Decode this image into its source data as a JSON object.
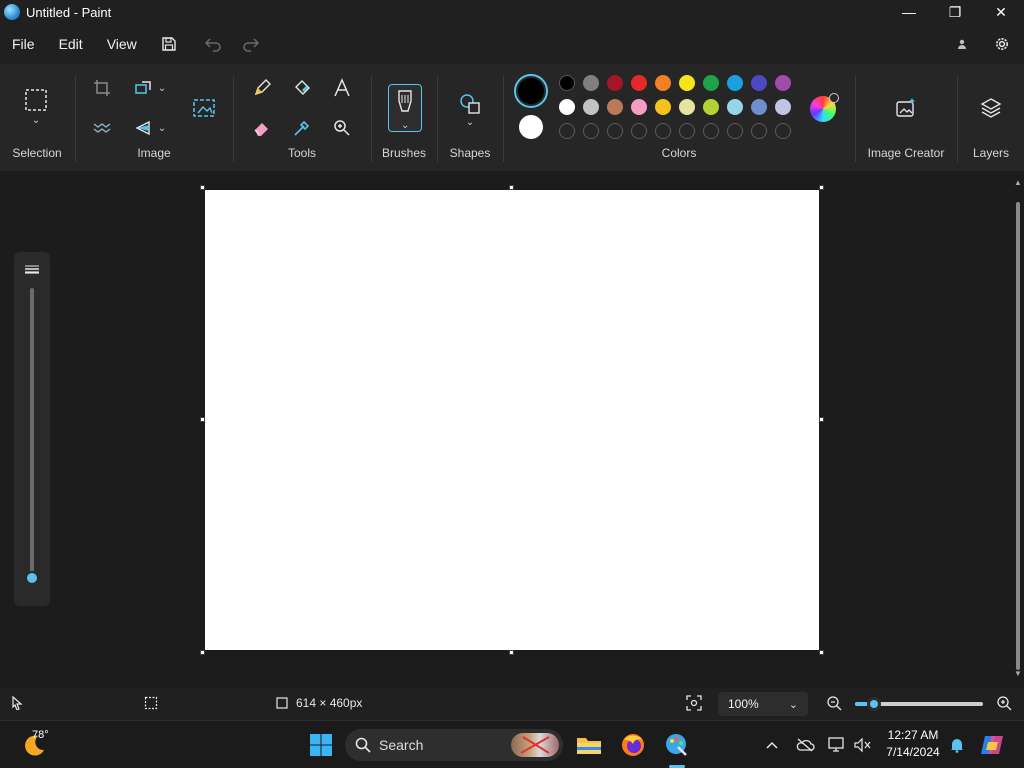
{
  "window": {
    "title": "Untitled - Paint",
    "minimize_glyph": "—",
    "restore_glyph": "❐",
    "close_glyph": "✕"
  },
  "menu": {
    "items": [
      "File",
      "Edit",
      "View"
    ]
  },
  "ribbon": {
    "groups": {
      "selection": "Selection",
      "image": "Image",
      "tools": "Tools",
      "brushes": "Brushes",
      "shapes": "Shapes",
      "colors": "Colors",
      "image_creator": "Image Creator",
      "layers": "Layers"
    },
    "colors": {
      "primary": "#000000",
      "secondary": "#ffffff",
      "row1": [
        "#000000",
        "#7f7f7f",
        "#a4152a",
        "#e52929",
        "#f48023",
        "#f5e41c",
        "#1ea34a",
        "#1a9fe0",
        "#4a4ac7",
        "#a14bab"
      ],
      "row2": [
        "#ffffff",
        "#c3c3c3",
        "#b97a57",
        "#f59ec3",
        "#f5c21b",
        "#e7e3a2",
        "#b4d233",
        "#96d5e8",
        "#6b8fcf",
        "#c3c3e6"
      ],
      "row3_empty_count": 10
    }
  },
  "canvas": {
    "background": "#ffffff"
  },
  "status": {
    "canvas_size": "614 × 460px",
    "zoom": "100%",
    "zoom_level_fraction": 0.15
  },
  "brush_size_level_fraction": 0.0,
  "taskbar": {
    "weather_temp": "78°",
    "search_label": "Search",
    "time": "12:27 AM",
    "date": "7/14/2024"
  },
  "accent": "#58c3ee"
}
